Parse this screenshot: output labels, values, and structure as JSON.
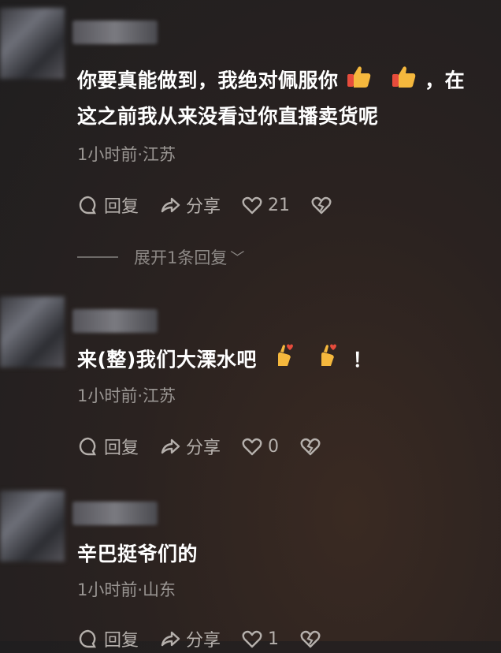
{
  "comments": [
    {
      "text_part1": "你要真能做到，我绝对佩服你",
      "text_part2": "，在",
      "text_line2": "这之前我从来没看过你直播卖货呢",
      "meta": "1小时前·江苏",
      "reply_label": "回复",
      "share_label": "分享",
      "likes": "21",
      "expand_label": "展开1条回复"
    },
    {
      "text_part1": "来(整)我们大溧水吧",
      "text_part2": "！",
      "meta": "1小时前·江苏",
      "reply_label": "回复",
      "share_label": "分享",
      "likes": "0"
    },
    {
      "text_part1": "辛巴挺爷们的",
      "meta": "1小时前·山东",
      "reply_label": "回复",
      "share_label": "分享",
      "likes": "1"
    }
  ],
  "icons": {
    "reply": "comment-bubble-icon",
    "share": "share-arrow-icon",
    "like": "heart-icon",
    "dislike": "broken-heart-icon",
    "thumbs_up": "thumbs-up-emoji",
    "finger_heart": "finger-heart-emoji"
  }
}
